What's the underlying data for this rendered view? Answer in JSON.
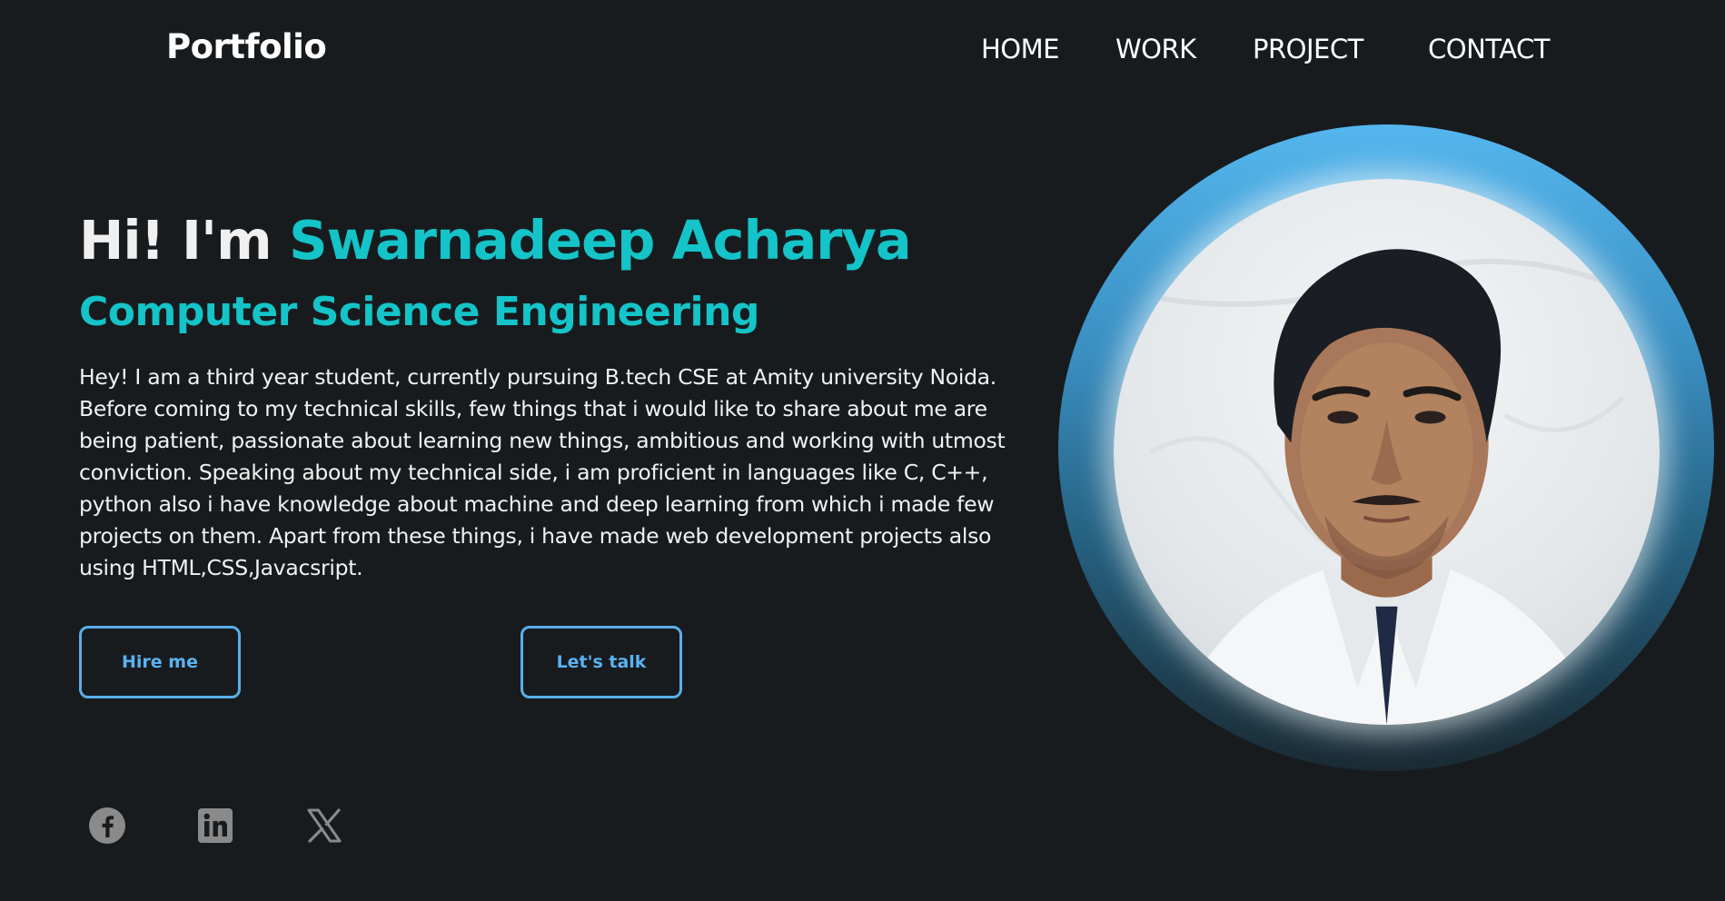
{
  "header": {
    "logo": "Portfolio",
    "nav": [
      "HOME",
      "WORK",
      "PROJECT",
      "CONTACT"
    ]
  },
  "hero": {
    "greeting": "Hi! I'm ",
    "name": "Swarnadeep Acharya",
    "subtitle": "Computer Science Engineering",
    "bio": "Hey! I am a third year student, currently pursuing B.tech CSE at Amity university Noida. Before coming to my technical skills, few things that i would like to share about me are being patient, passionate about learning new things, ambitious and working with utmost conviction. Speaking about my technical side, i am proficient in languages like C, C++, python also i have knowledge about machine and deep learning from which i made few projects on them. Apart from these things, i have made web development projects also using HTML,CSS,Javacsript.",
    "hire_label": "Hire me",
    "talk_label": "Let's talk"
  },
  "social": {
    "icons": [
      "facebook-icon",
      "linkedin-icon",
      "x-twitter-icon"
    ]
  },
  "profile": {
    "image_subject": "profile-photo"
  },
  "colors": {
    "background": "#181b1e",
    "accent": "#14c4c8",
    "button": "#5aaee8",
    "ring_top": "#54b6ee"
  }
}
